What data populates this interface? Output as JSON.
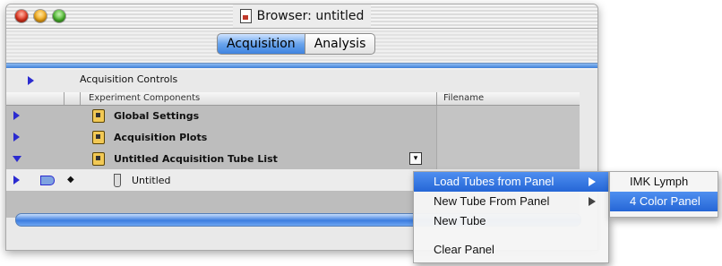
{
  "window": {
    "title": "Browser: untitled"
  },
  "tabs": [
    {
      "label": "Acquisition"
    },
    {
      "label": "Analysis"
    }
  ],
  "panel": {
    "acquisition_controls": "Acquisition Controls"
  },
  "table": {
    "columns": [
      "Experiment Components",
      "Filename"
    ],
    "rows": [
      {
        "label": "Global Settings"
      },
      {
        "label": "Acquisition Plots"
      },
      {
        "label": "Untitled Acquisition Tube List"
      },
      {
        "label": "Untitled"
      }
    ]
  },
  "context_menu": {
    "items": [
      "Load Tubes from Panel",
      "New Tube From Panel",
      "New Tube",
      "Clear Panel"
    ]
  },
  "submenu": {
    "items": [
      "IMK Lymph",
      "4 Color Panel"
    ]
  },
  "colors": {
    "accent": "#3f83e0",
    "highlight": "#2566d6"
  }
}
